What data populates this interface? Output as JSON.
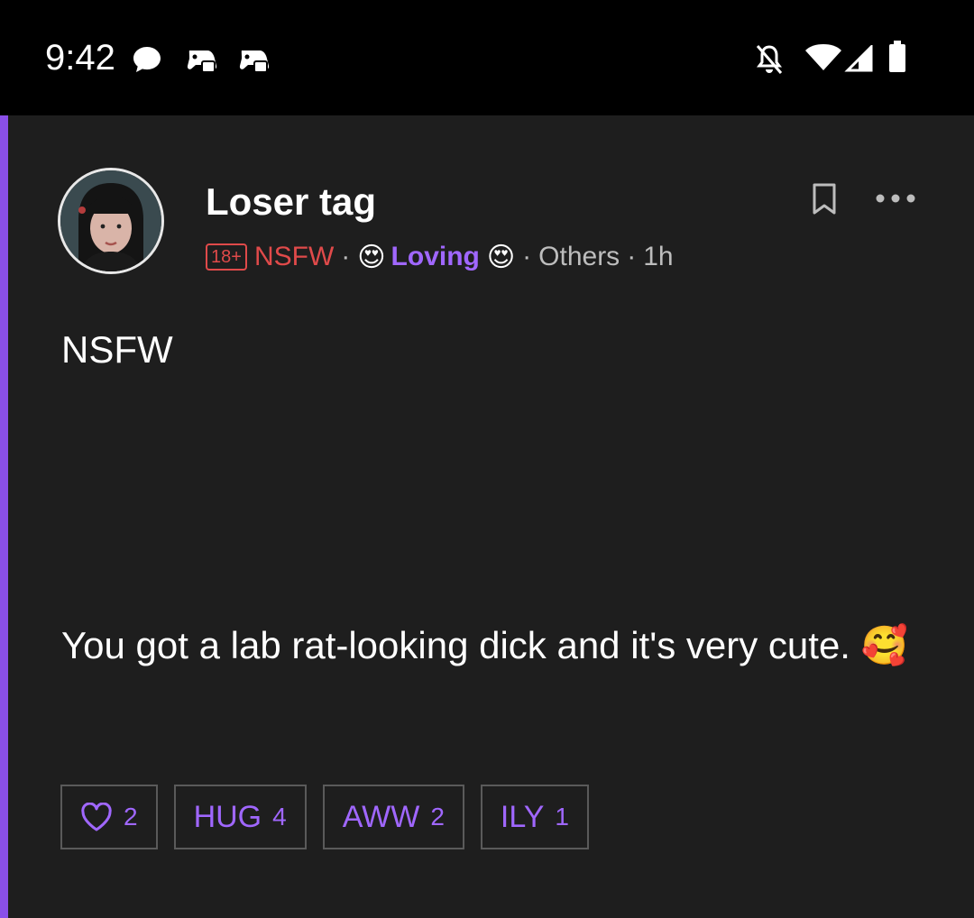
{
  "status_bar": {
    "time": "9:42",
    "left_icons": [
      "chat-bubble-icon",
      "gamepad-notification-icon",
      "gamepad-notification-icon"
    ],
    "right_icons": [
      "bell-off-icon",
      "wifi-icon",
      "signal-icon",
      "battery-icon"
    ]
  },
  "post": {
    "title": "Loser tag",
    "age_badge": "18+",
    "nsfw_label": "NSFW",
    "separator": "·",
    "mood_emoji": "😍",
    "mood": "Loving",
    "category": "Others",
    "time_ago": "1h",
    "heading": "NSFW",
    "body": "You got a lab rat-looking dick and it's very cute. 🥰",
    "accent_color": "#8a4fe8",
    "nsfw_color": "#e04a4a"
  },
  "reactions": [
    {
      "icon": "heart-outline-icon",
      "label": "",
      "count": "2"
    },
    {
      "label": "HUG",
      "count": "4"
    },
    {
      "label": "AWW",
      "count": "2"
    },
    {
      "label": "ILY",
      "count": "1"
    }
  ]
}
